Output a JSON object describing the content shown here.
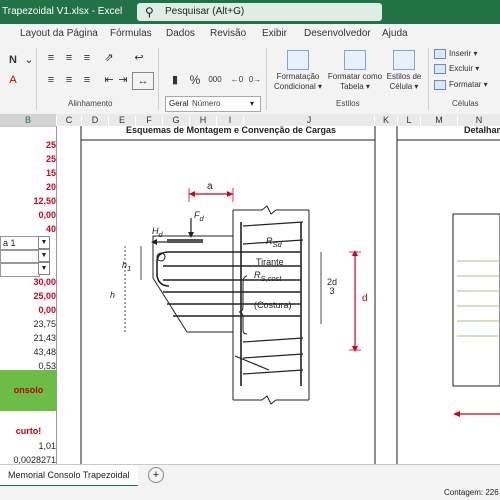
{
  "title_bar": {
    "title": "Trapezoidal V1.xlsx  -  Excel",
    "search_placeholder": "Pesquisar (Alt+G)"
  },
  "menu": [
    "Layout da Página",
    "Fórmulas",
    "Dados",
    "Revisão",
    "Exibir",
    "Desenvolvedor",
    "Ajuda"
  ],
  "ribbon": {
    "font_name": "Geral",
    "groups": {
      "alinhamento": "Alinhamento",
      "numero": "Número",
      "estilos": "Estilos",
      "celulas": "Células"
    },
    "format_conditional": "Formatação\nCondicional",
    "format_table": "Formatar como\nTabela",
    "cell_styles": "Estilos de\nCélula",
    "insert": "Inserir",
    "delete": "Excluir",
    "format": "Formatar",
    "percent": "%",
    "thousands": "000"
  },
  "columns": [
    "B",
    "C",
    "D",
    "E",
    "F",
    "G",
    "H",
    "I",
    "J",
    "K",
    "L",
    "M",
    "N"
  ],
  "cells": {
    "b_values_red_1": [
      "25",
      "25",
      "15",
      "20",
      "12,50",
      "0,00",
      "40"
    ],
    "dropdown_label": "a 1",
    "b_values_red_2": [
      "30,00",
      "25,00",
      "0,00"
    ],
    "b_values_black": [
      "23,75",
      "21,43",
      "43,48",
      "0,53"
    ],
    "green_message": "onsolo curto!",
    "b_values_bottom": [
      "1,01",
      "0,0028271"
    ]
  },
  "sheet": {
    "heading": "Esquemas de Montagem e Convenção de Cargas",
    "heading_right": "Detalham",
    "labels": {
      "a": "a",
      "fd": "F",
      "fd_sub": "d",
      "hd": "H",
      "hd_sub": "d",
      "rsd": "R",
      "rsd_sub": "Sd",
      "tirante": "Tirante",
      "rscost": "R",
      "rscost_sub": "S,cost",
      "costura": "(Costura)",
      "h": "h",
      "h1": "h",
      "h1_sub": "1",
      "d": "d",
      "two_d_three_top": "2d",
      "two_d_three_bot": "3"
    }
  },
  "sheet_tabs": {
    "active": "Memorial Consolo Trapezoidal",
    "add": "+"
  },
  "status_bar": {
    "count": "Contagem: 226"
  },
  "colors": {
    "excel_green": "#217346",
    "accent_red": "#d0021b"
  }
}
